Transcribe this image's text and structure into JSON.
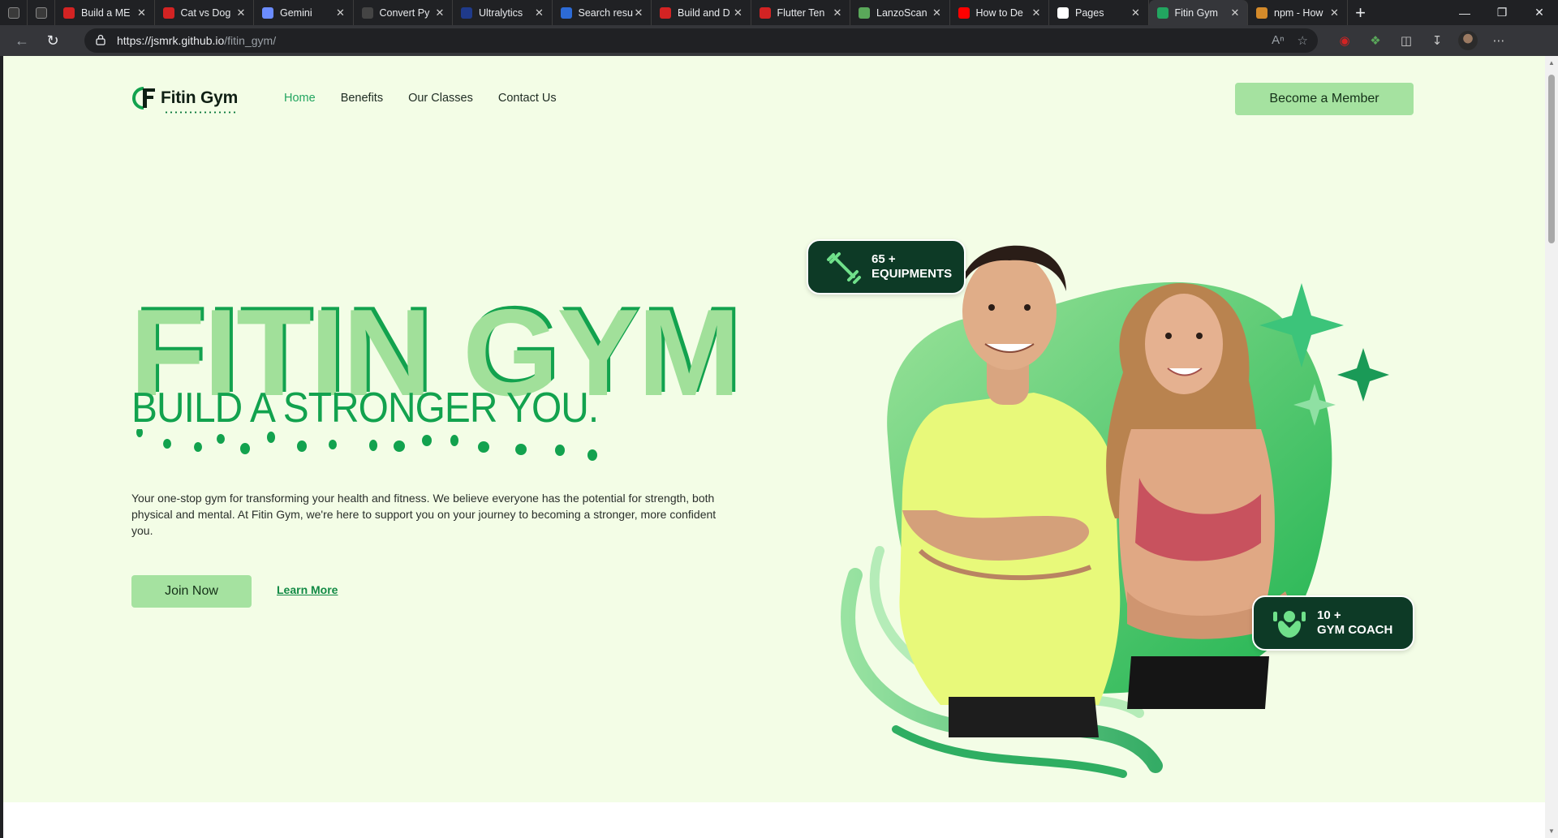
{
  "browser": {
    "tabs": [
      {
        "title": "",
        "favicon": "square-app-icon",
        "color": "#555555",
        "mini": true
      },
      {
        "title": "",
        "favicon": "square-app-icon",
        "color": "#555555",
        "mini": true
      },
      {
        "title": "Build a ME",
        "favicon": "youtube-icon",
        "color": "#d32323"
      },
      {
        "title": "Cat vs Dog",
        "favicon": "youtube-icon",
        "color": "#d32323"
      },
      {
        "title": "Gemini",
        "favicon": "gemini-icon",
        "color": "#6b8cff"
      },
      {
        "title": "Convert Py",
        "favicon": "medium-icon",
        "color": "#444444"
      },
      {
        "title": "Ultralytics",
        "favicon": "ultralytics-icon",
        "color": "#1f3a8a"
      },
      {
        "title": "Search resu",
        "favicon": "search-icon",
        "color": "#2d6bd6"
      },
      {
        "title": "Build and D",
        "favicon": "youtube-icon",
        "color": "#d32323"
      },
      {
        "title": "Flutter Ten",
        "favicon": "youtube-icon",
        "color": "#d32323"
      },
      {
        "title": "LanzoScan",
        "favicon": "lanzo-icon",
        "color": "#5aa85a"
      },
      {
        "title": "How to De",
        "favicon": "youtube-icon",
        "color": "#ff0000"
      },
      {
        "title": "Pages",
        "favicon": "github-icon",
        "color": "#ffffff"
      },
      {
        "title": "Fitin Gym",
        "favicon": "fitin-icon",
        "color": "#22a560",
        "active": true
      },
      {
        "title": "npm - How",
        "favicon": "npm-icon",
        "color": "#d48a2a"
      }
    ],
    "url_host": "https://jsmrk.github.io",
    "url_path": "/fitin_gym/"
  },
  "site": {
    "logo_text": "Fitin Gym",
    "nav": [
      "Home",
      "Benefits",
      "Our Classes",
      "Contact Us"
    ],
    "member_button": "Become a Member",
    "hero_title": "FITIN GYM",
    "hero_subtitle": "BUILD A STRONGER YOU.",
    "hero_description": "Your one-stop gym for transforming your health and fitness. We believe everyone has the potential for strength, both physical and mental. At Fitin Gym, we're here to support you on your journey to becoming a stronger, more confident you.",
    "join_button": "Join Now",
    "learn_more": "Learn More",
    "badge_equipments_count": "65 +",
    "badge_equipments_label": "EQUIPMENTS",
    "badge_coach_count": "10 +",
    "badge_coach_label": "GYM COACH"
  },
  "colors": {
    "hero_bg": "#f3fde6",
    "accent_dark": "#12a24e",
    "accent_light": "#a5e2a0",
    "badge_bg": "#0d3a26"
  }
}
